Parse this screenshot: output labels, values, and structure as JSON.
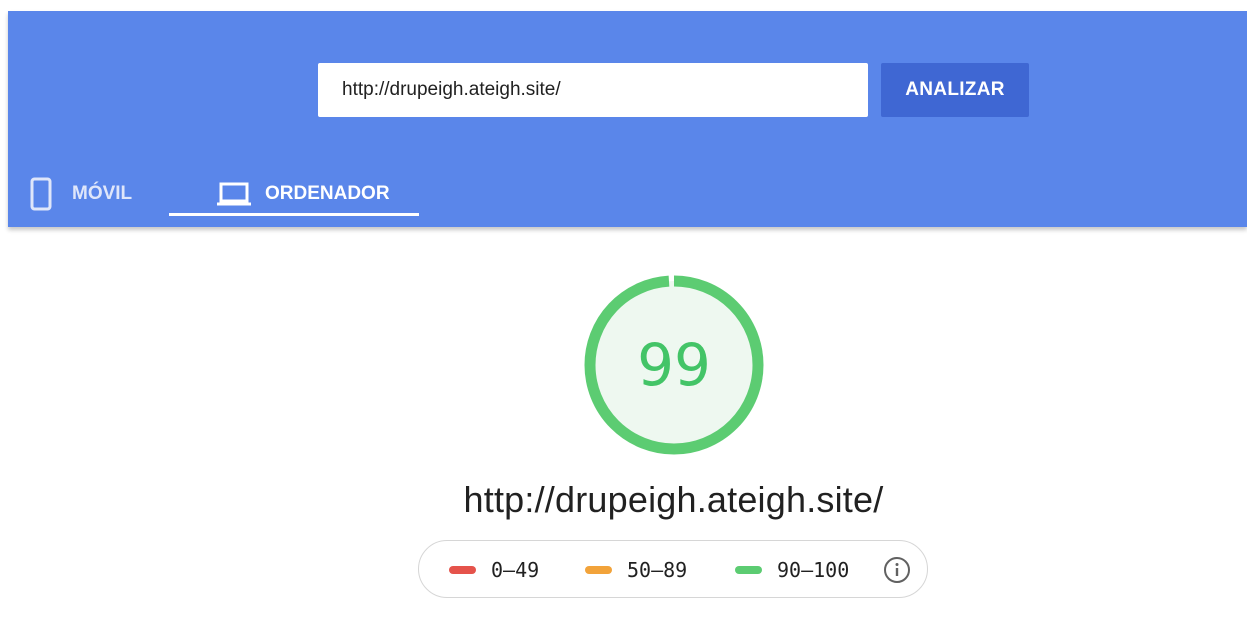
{
  "search": {
    "url_value": "http://drupeigh.ateigh.site/",
    "analyze_label": "ANALIZAR"
  },
  "tabs": [
    {
      "label": "MÓVIL",
      "icon": "smartphone-icon",
      "selected": false
    },
    {
      "label": "ORDENADOR",
      "icon": "laptop-icon",
      "selected": true
    }
  ],
  "result": {
    "score": "99",
    "score_fraction": 0.99,
    "url": "http://drupeigh.ateigh.site/"
  },
  "legend": [
    {
      "range": "0–49",
      "color": "#e5534b"
    },
    {
      "range": "50–89",
      "color": "#f2a33a"
    },
    {
      "range": "90–100",
      "color": "#5ccc72"
    }
  ],
  "legend_info_icon": "info-icon",
  "colors": {
    "header_bg": "#5a86ea",
    "button_bg": "#3f67d3",
    "score_green": "#43c467",
    "gauge_ring": "#5ccc72",
    "gauge_fill": "#eef8f0"
  }
}
